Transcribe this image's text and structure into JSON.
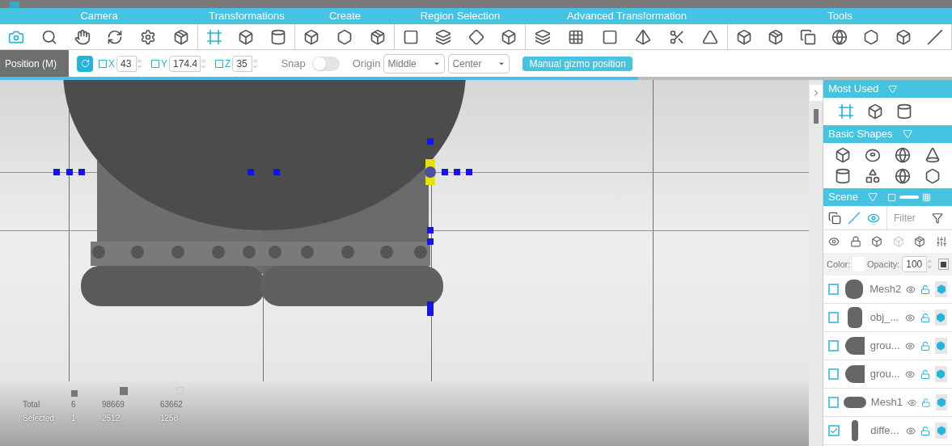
{
  "toolbar": {
    "sections": [
      {
        "label": "Camera",
        "tools": [
          {
            "selected": true
          },
          {
            "selected": false
          },
          {
            "selected": false
          },
          {
            "selected": false
          },
          {
            "selected": false
          },
          {
            "selected": false
          }
        ]
      },
      {
        "label": "Transformations",
        "tools": [
          {
            "selected": true
          },
          {
            "selected": false
          },
          {
            "selected": false
          }
        ]
      },
      {
        "label": "Create",
        "tools": [
          {
            "selected": false
          },
          {
            "selected": false
          },
          {
            "selected": false
          }
        ]
      },
      {
        "label": "Region Selection",
        "tools": [
          {
            "selected": false
          },
          {
            "selected": false
          },
          {
            "selected": false
          },
          {
            "selected": false
          }
        ]
      },
      {
        "label": "Advanced Transformation",
        "tools": [
          {
            "selected": false
          },
          {
            "selected": false
          },
          {
            "selected": false
          },
          {
            "selected": false
          },
          {
            "selected": false
          },
          {
            "selected": false
          }
        ]
      },
      {
        "label": "Tools",
        "tools": [
          {
            "selected": false
          },
          {
            "selected": false
          },
          {
            "selected": false
          },
          {
            "selected": false
          },
          {
            "selected": false
          },
          {
            "selected": false
          },
          {
            "selected": false
          }
        ]
      }
    ]
  },
  "options": {
    "mode": "Position (M)",
    "axes": [
      {
        "label": "X",
        "checked": false,
        "value": "43"
      },
      {
        "label": "Y",
        "checked": false,
        "value": "174.4"
      },
      {
        "label": "Z",
        "checked": false,
        "value": "35"
      }
    ],
    "snap": {
      "label": "Snap",
      "on": false
    },
    "origin": {
      "label": "Origin",
      "selects": [
        "Middle",
        "Center"
      ]
    },
    "gizmo_button": "Manual gizmo position",
    "progress": {
      "level": 0.67
    }
  },
  "stats": {
    "rows": [
      {
        "label": "Total",
        "selected": false,
        "values": [
          "6",
          "98669",
          "63662"
        ]
      },
      {
        "label": "Selected",
        "selected": true,
        "values": [
          "1",
          "2512",
          "1258"
        ]
      }
    ]
  },
  "panel": {
    "most_used": {
      "title": "Most Used"
    },
    "basic_shapes": {
      "title": "Basic Shapes"
    },
    "scene": {
      "title": "Scene",
      "filter_placeholder": "Filter",
      "color_label": "Color:",
      "opacity_label": "Opacity:",
      "opacity": "100",
      "objects": [
        {
          "name": "Mesh2",
          "kind": "mesh",
          "checked": false
        },
        {
          "name": "obj_...",
          "kind": "cylinder",
          "checked": false
        },
        {
          "name": "grou...",
          "kind": "bell",
          "checked": false
        },
        {
          "name": "grou...",
          "kind": "bell",
          "checked": false
        },
        {
          "name": "Mesh1",
          "kind": "disc",
          "checked": false
        },
        {
          "name": "diffe...",
          "kind": "rod",
          "checked": true
        }
      ]
    }
  }
}
